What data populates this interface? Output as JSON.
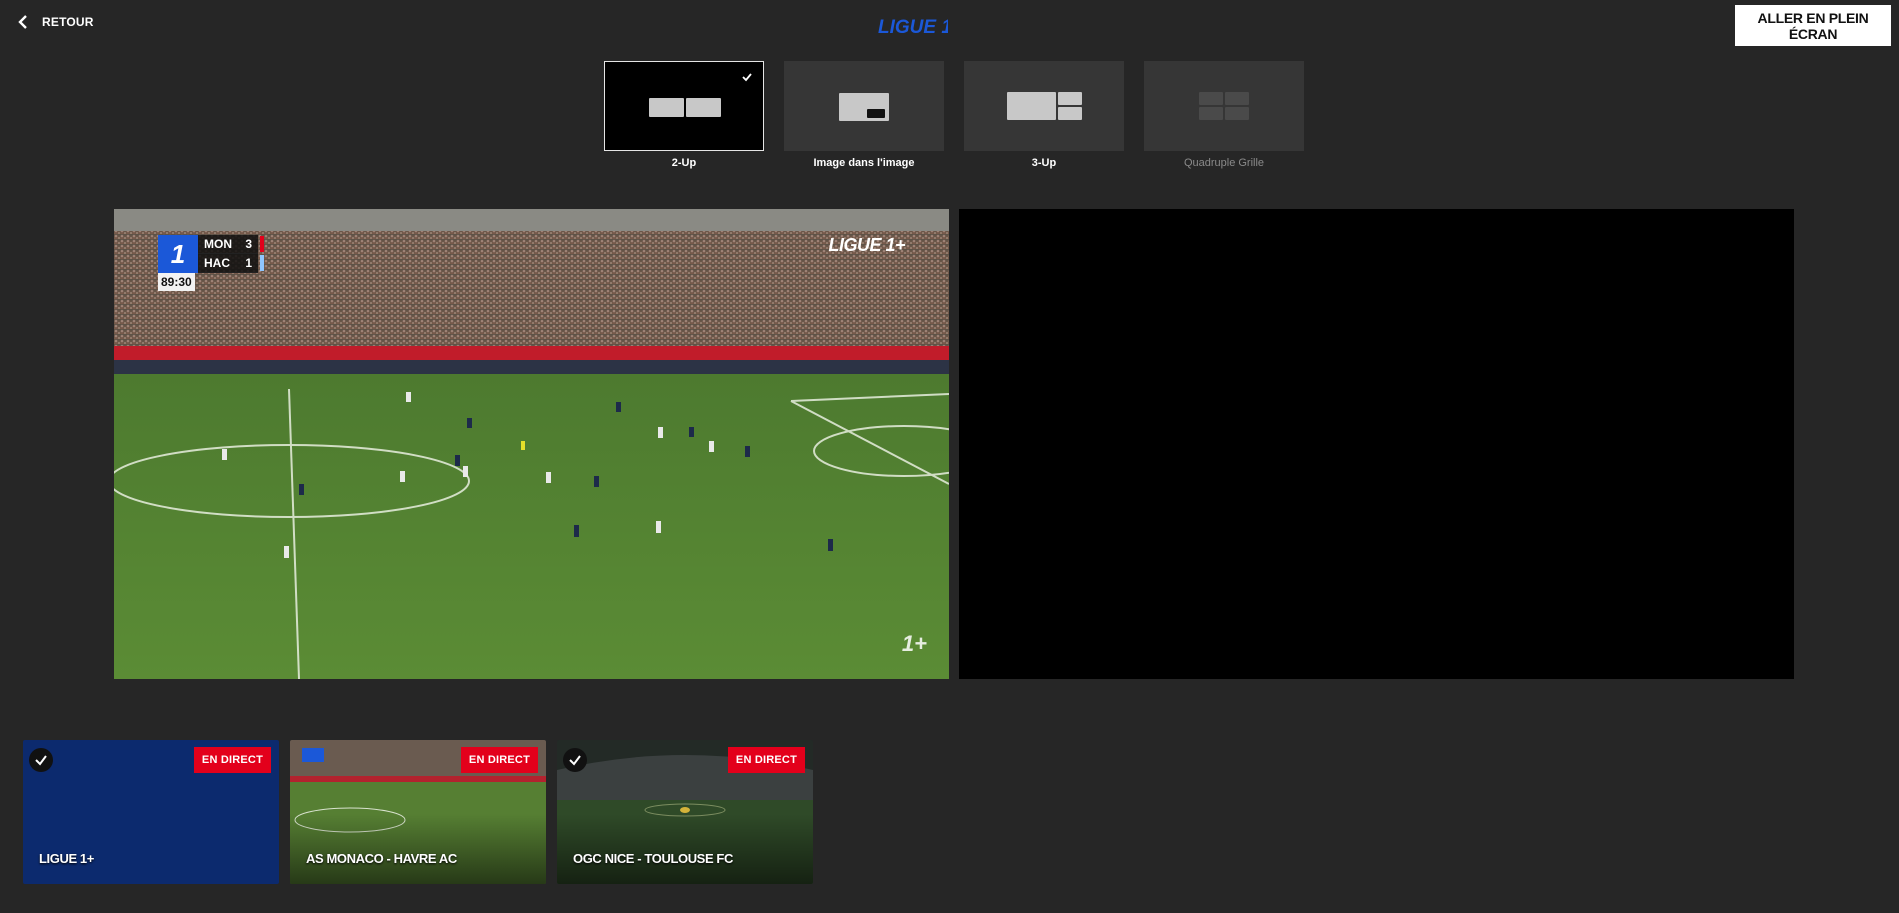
{
  "header": {
    "back_label": "RETOUR",
    "logo_text": "LIGUE 1+",
    "fullscreen_label": "ALLER EN PLEIN ÉCRAN"
  },
  "layouts": [
    {
      "label": "2-Up",
      "selected": true,
      "disabled": false
    },
    {
      "label": "Image dans l'image",
      "selected": false,
      "disabled": false
    },
    {
      "label": "3-Up",
      "selected": false,
      "disabled": false
    },
    {
      "label": "Quadruple Grille",
      "selected": false,
      "disabled": true
    }
  ],
  "player": {
    "scoreboard": {
      "home": {
        "team": "MON",
        "score": "3",
        "color": "#e3001b"
      },
      "away": {
        "team": "HAC",
        "score": "1",
        "color": "#8fc6ff"
      },
      "clock": "89:30"
    },
    "overlay_logo": "LIGUE 1+",
    "watermark": "1+"
  },
  "channels": [
    {
      "title": "LIGUE 1+",
      "badge": "EN DIRECT",
      "checked": true
    },
    {
      "title": "AS MONACO - HAVRE AC",
      "badge": "EN DIRECT",
      "checked": false
    },
    {
      "title": "OGC NICE - TOULOUSE FC",
      "badge": "EN DIRECT",
      "checked": true
    }
  ],
  "colors": {
    "background": "#262626",
    "live_badge": "#e3001b",
    "brand_blue": "#1b58d8"
  }
}
